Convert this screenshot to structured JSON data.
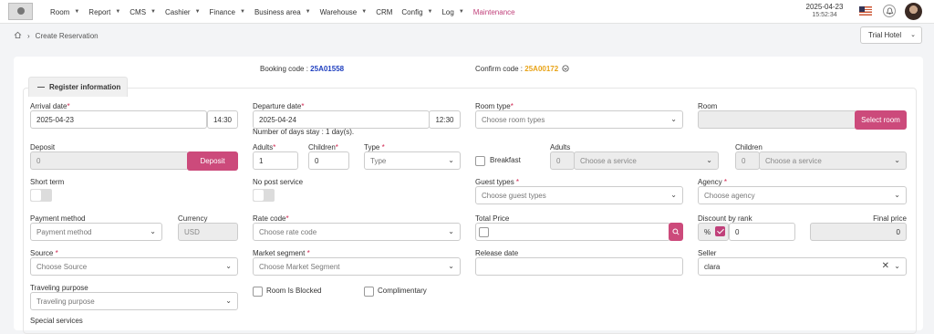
{
  "nav": {
    "items": [
      {
        "label": "Room",
        "chevron": true
      },
      {
        "label": "Report",
        "chevron": true
      },
      {
        "label": "CMS",
        "chevron": true
      },
      {
        "label": "Cashier",
        "chevron": true
      },
      {
        "label": "Finance",
        "chevron": true
      },
      {
        "label": "Business area",
        "chevron": true
      },
      {
        "label": "Warehouse",
        "chevron": true
      },
      {
        "label": "CRM",
        "chevron": false
      },
      {
        "label": "Config",
        "chevron": true
      },
      {
        "label": "Log",
        "chevron": true
      },
      {
        "label": "Maintenance",
        "chevron": false,
        "active": true
      }
    ],
    "date": "2025-04-23",
    "time": "15:52:34"
  },
  "breadcrumb": {
    "current": "Create Reservation"
  },
  "hotel_select": {
    "value": "Trial Hotel"
  },
  "codes": {
    "booking_label": "Booking code :",
    "booking_value": "25A01558",
    "confirm_label": "Confirm code :",
    "confirm_value": "25A00172"
  },
  "section_tab": {
    "label": "Register information"
  },
  "form": {
    "arrival_label": "Arrival date",
    "arrival_date": "2025-04-23",
    "arrival_time": "14:30",
    "departure_label": "Departure date",
    "departure_date": "2025-04-24",
    "departure_time": "12:30",
    "days_stay": "Number of days stay : 1 day(s).",
    "room_type_label": "Room type",
    "room_type_placeholder": "Choose room types",
    "room_label": "Room",
    "select_room_button": "Select room",
    "deposit_label": "Deposit",
    "deposit_value": "0",
    "deposit_button": "Deposit",
    "adults_label": "Adults",
    "adults_value": "1",
    "children_label": "Children",
    "children_value": "0",
    "type_label": "Type",
    "type_placeholder": "Type",
    "breakfast_label": "Breakfast",
    "bf_adults_label": "Adults",
    "bf_adults_value": "0",
    "bf_adults_service": "Choose a service",
    "bf_children_label": "Children",
    "bf_children_value": "0",
    "bf_children_service": "Choose a service",
    "short_term_label": "Short term",
    "no_post_label": "No post service",
    "guest_types_label": "Guest types",
    "guest_types_placeholder": "Choose guest types",
    "agency_label": "Agency",
    "agency_placeholder": "Choose agency",
    "payment_method_label": "Payment method",
    "payment_method_value": "Payment method",
    "currency_label": "Currency",
    "currency_value": "USD",
    "rate_code_label": "Rate code",
    "rate_code_placeholder": "Choose rate code",
    "total_price_label": "Total Price",
    "discount_label": "Discount by rank",
    "discount_unit": "%",
    "discount_value": "0",
    "final_price_label": "Final price",
    "final_price_value": "0",
    "source_label": "Source",
    "source_placeholder": "Choose Source",
    "market_label": "Market segment",
    "market_placeholder": "Choose Market Segment",
    "release_label": "Release date",
    "seller_label": "Seller",
    "seller_value": "clara",
    "purpose_label": "Traveling purpose",
    "purpose_placeholder": "Traveling purpose",
    "room_blocked_label": "Room Is Blocked",
    "complimentary_label": "Complimentary",
    "special_services_label": "Special services"
  },
  "colors": {
    "accent": "#cc4a7b",
    "booking_code": "#1f3fbf",
    "confirm_code": "#e8a317"
  }
}
